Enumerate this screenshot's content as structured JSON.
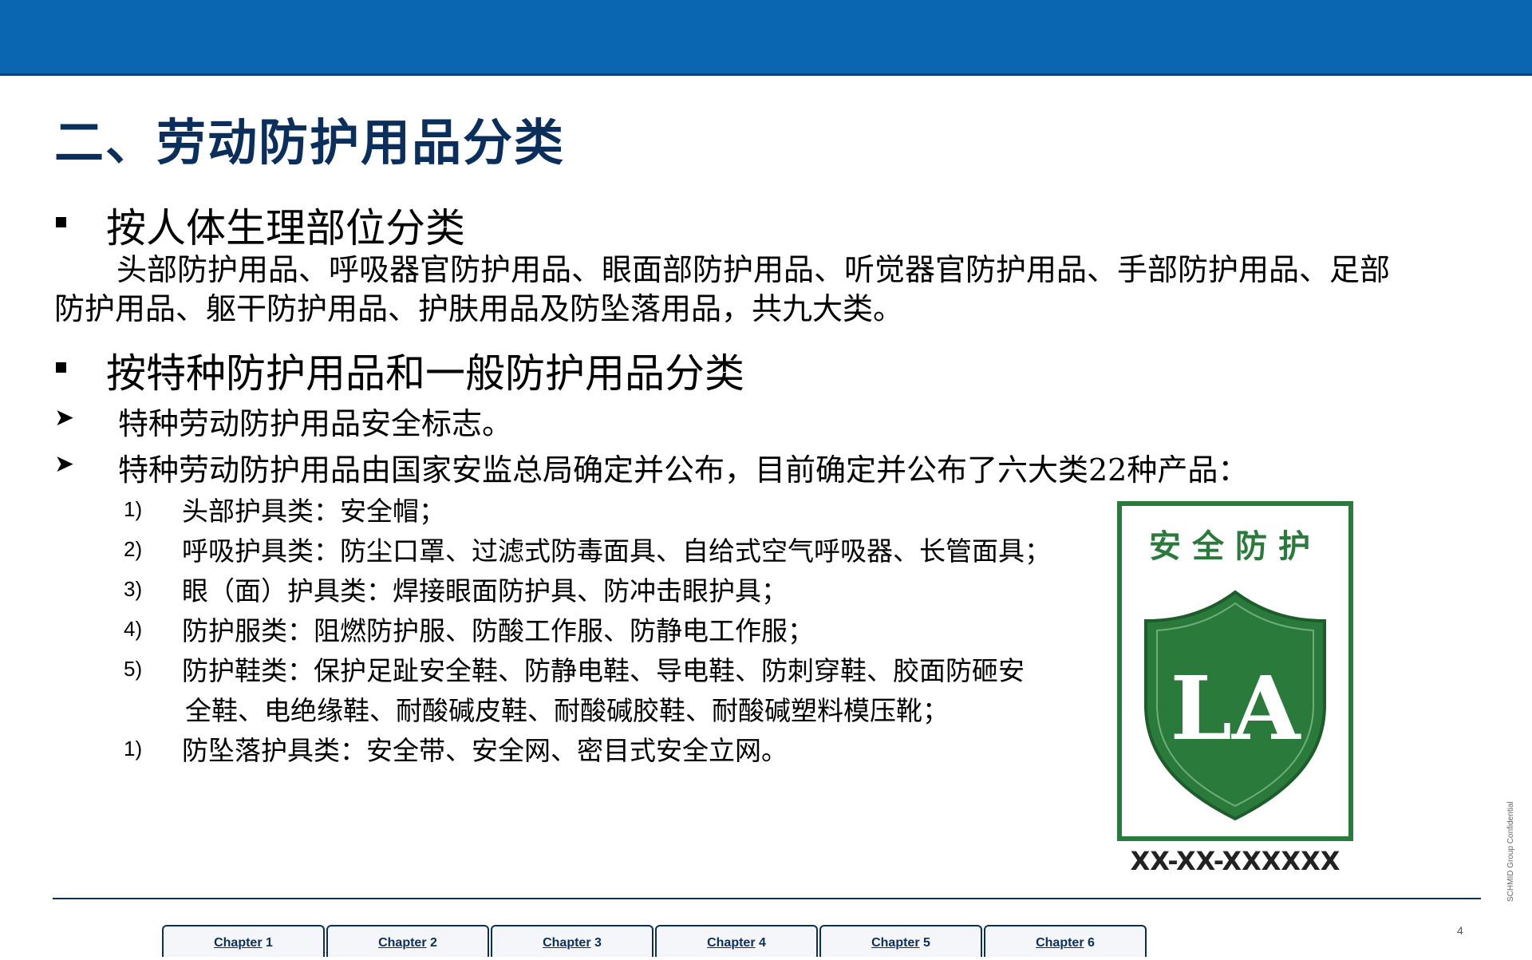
{
  "title": "二、劳动防护用品分类",
  "section1": {
    "heading": "按人体生理部位分类",
    "para_line1": "头部防护用品、呼吸器官防护用品、眼面部防护用品、听觉器官防护用品、手部防护用品、足部",
    "para_line2": "防护用品、躯干防护用品、护肤用品及防坠落用品，共九大类。"
  },
  "section2": {
    "heading": "按特种防护用品和一般防护用品分类",
    "sub1": "特种劳动防护用品安全标志。",
    "sub2": "特种劳动防护用品由国家安监总局确定并公布，目前确定并公布了六大类22种产品：",
    "items": [
      {
        "num": "1)",
        "text": "头部护具类：安全帽；"
      },
      {
        "num": "2)",
        "text": "呼吸护具类：防尘口罩、过滤式防毒面具、自给式空气呼吸器、长管面具；"
      },
      {
        "num": "3)",
        "text": "眼（面）护具类：焊接眼面防护具、防冲击眼护具；"
      },
      {
        "num": "4)",
        "text": "防护服类：阻燃防护服、防酸工作服、防静电工作服；"
      },
      {
        "num": "5)",
        "text": "防护鞋类：保护足趾安全鞋、防静电鞋、导电鞋、防刺穿鞋、胶面防砸安",
        "cont": "全鞋、电绝缘鞋、耐酸碱皮鞋、耐酸碱胶鞋、耐酸碱塑料模压靴；"
      },
      {
        "num": "1)",
        "text": "防坠落护具类：安全带、安全网、密目式安全立网。"
      }
    ]
  },
  "logo": {
    "top_text": "安全防护",
    "shield_text": "LA",
    "code": "XX-XX-XXXXXX",
    "color": "#2a7a3b"
  },
  "footer": {
    "confidential": "SCHMID Group   Confidential",
    "page_number": "4",
    "tabs": [
      {
        "word": "Chapter",
        "num": "1"
      },
      {
        "word": "Chapter",
        "num": "2"
      },
      {
        "word": "Chapter",
        "num": "3"
      },
      {
        "word": "Chapter",
        "num": "4"
      },
      {
        "word": "Chapter",
        "num": "5"
      },
      {
        "word": "Chapter",
        "num": "6"
      }
    ]
  }
}
